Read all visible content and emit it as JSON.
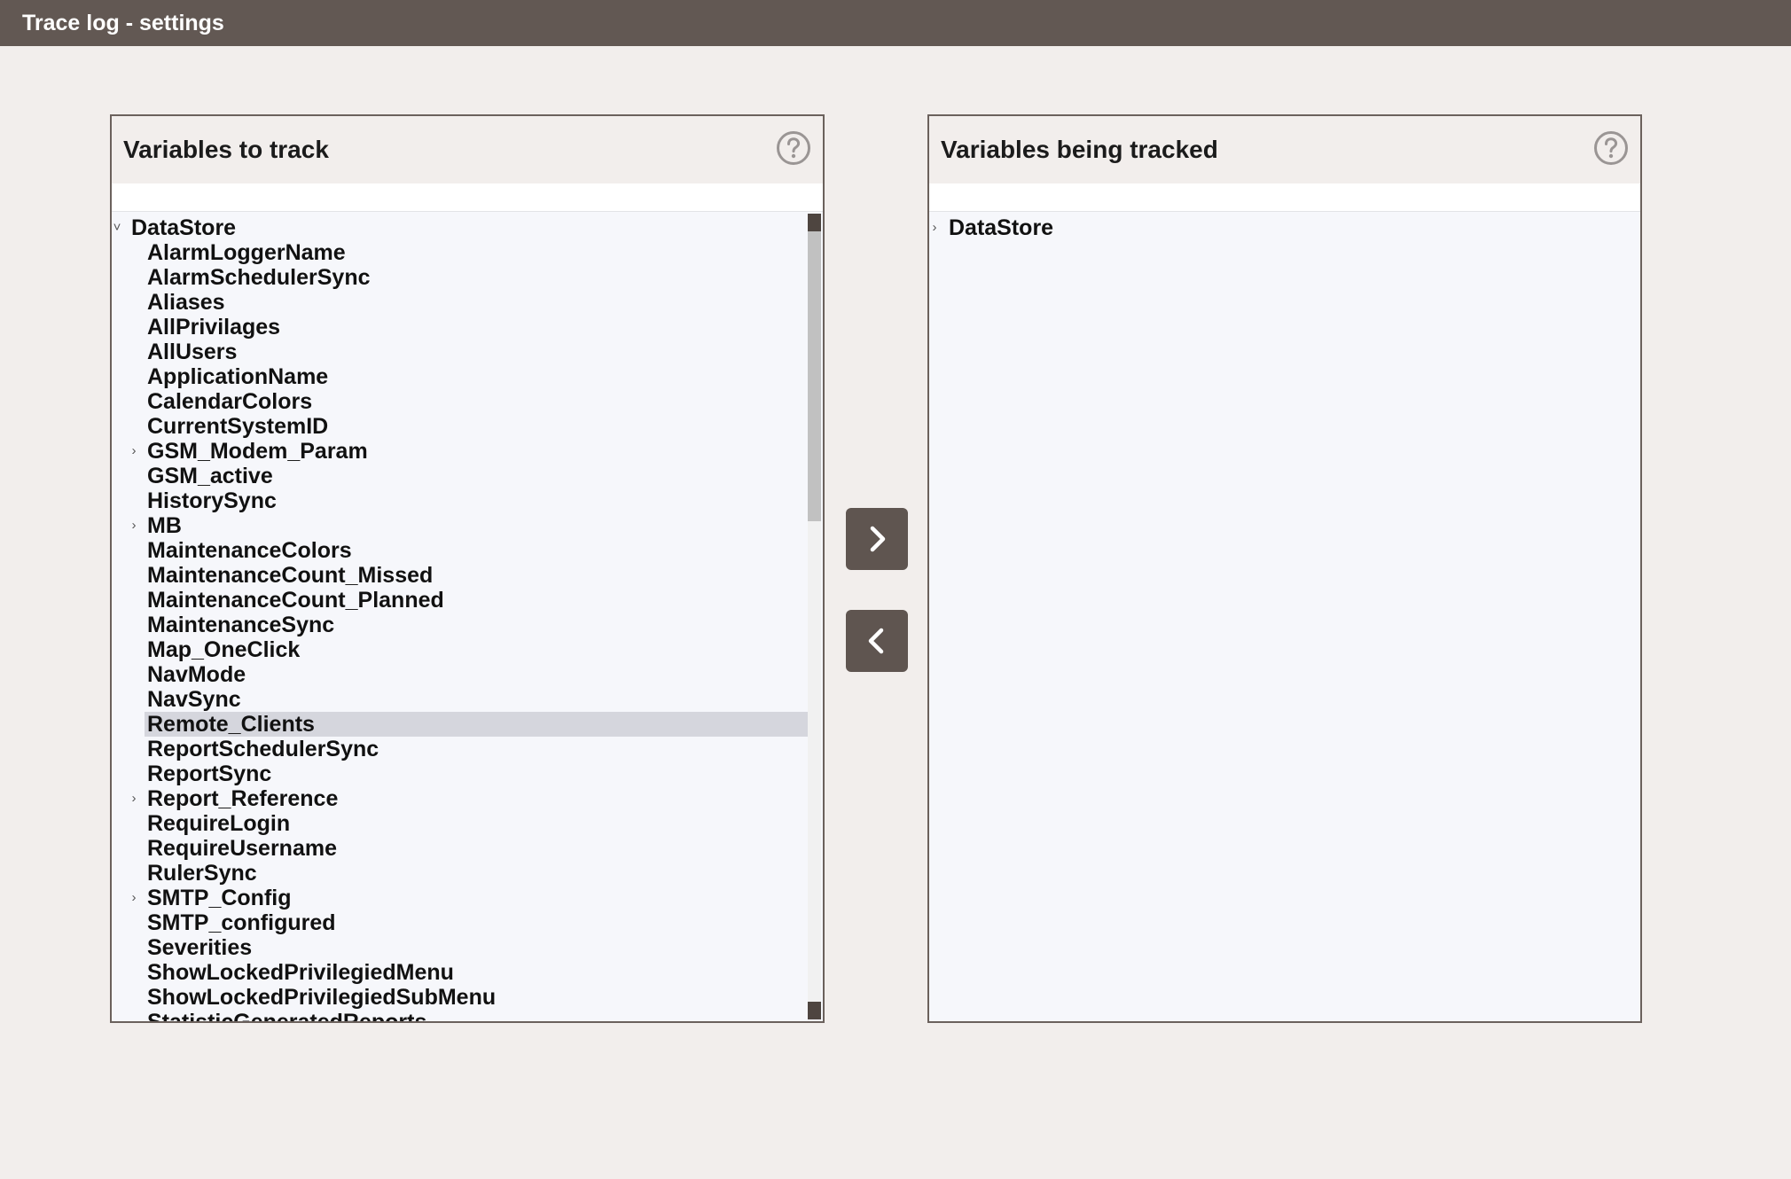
{
  "window": {
    "title": "Trace log - settings"
  },
  "left_panel": {
    "title": "Variables to track",
    "help_icon": "help-icon",
    "filter_value": "",
    "tree": [
      {
        "label": "DataStore",
        "level": 0,
        "expander": "expanded"
      },
      {
        "label": "AlarmLoggerName",
        "level": 1,
        "expander": "none"
      },
      {
        "label": "AlarmSchedulerSync",
        "level": 1,
        "expander": "none"
      },
      {
        "label": "Aliases",
        "level": 1,
        "expander": "none"
      },
      {
        "label": "AllPrivilages",
        "level": 1,
        "expander": "none"
      },
      {
        "label": "AllUsers",
        "level": 1,
        "expander": "none"
      },
      {
        "label": "ApplicationName",
        "level": 1,
        "expander": "none"
      },
      {
        "label": "CalendarColors",
        "level": 1,
        "expander": "none"
      },
      {
        "label": "CurrentSystemID",
        "level": 1,
        "expander": "none"
      },
      {
        "label": "GSM_Modem_Param",
        "level": 1,
        "expander": "collapsed"
      },
      {
        "label": "GSM_active",
        "level": 1,
        "expander": "none"
      },
      {
        "label": "HistorySync",
        "level": 1,
        "expander": "none"
      },
      {
        "label": "MB",
        "level": 1,
        "expander": "collapsed"
      },
      {
        "label": "MaintenanceColors",
        "level": 1,
        "expander": "none"
      },
      {
        "label": "MaintenanceCount_Missed",
        "level": 1,
        "expander": "none"
      },
      {
        "label": "MaintenanceCount_Planned",
        "level": 1,
        "expander": "none"
      },
      {
        "label": "MaintenanceSync",
        "level": 1,
        "expander": "none"
      },
      {
        "label": "Map_OneClick",
        "level": 1,
        "expander": "none"
      },
      {
        "label": "NavMode",
        "level": 1,
        "expander": "none"
      },
      {
        "label": "NavSync",
        "level": 1,
        "expander": "none"
      },
      {
        "label": "Remote_Clients",
        "level": 1,
        "expander": "none",
        "selected": true
      },
      {
        "label": "ReportSchedulerSync",
        "level": 1,
        "expander": "none"
      },
      {
        "label": "ReportSync",
        "level": 1,
        "expander": "none"
      },
      {
        "label": "Report_Reference",
        "level": 1,
        "expander": "collapsed"
      },
      {
        "label": "RequireLogin",
        "level": 1,
        "expander": "none"
      },
      {
        "label": "RequireUsername",
        "level": 1,
        "expander": "none"
      },
      {
        "label": "RulerSync",
        "level": 1,
        "expander": "none"
      },
      {
        "label": "SMTP_Config",
        "level": 1,
        "expander": "collapsed"
      },
      {
        "label": "SMTP_configured",
        "level": 1,
        "expander": "none"
      },
      {
        "label": "Severities",
        "level": 1,
        "expander": "none"
      },
      {
        "label": "ShowLockedPrivilegiedMenu",
        "level": 1,
        "expander": "none"
      },
      {
        "label": "ShowLockedPrivilegiedSubMenu",
        "level": 1,
        "expander": "none"
      },
      {
        "label": "StatisticGeneratedReports",
        "level": 1,
        "expander": "none"
      }
    ]
  },
  "right_panel": {
    "title": "Variables being tracked",
    "help_icon": "help-icon",
    "filter_value": "",
    "tree": [
      {
        "label": "DataStore",
        "level": 0,
        "expander": "collapsed"
      }
    ]
  },
  "buttons": {
    "add_icon": "chevron-right-icon",
    "remove_icon": "chevron-left-icon"
  },
  "colors": {
    "titlebar": "#625853",
    "background": "#f2eeec",
    "panel_border": "#6b615c",
    "button": "#5f5550",
    "selected_row": "#d5d6dd"
  }
}
